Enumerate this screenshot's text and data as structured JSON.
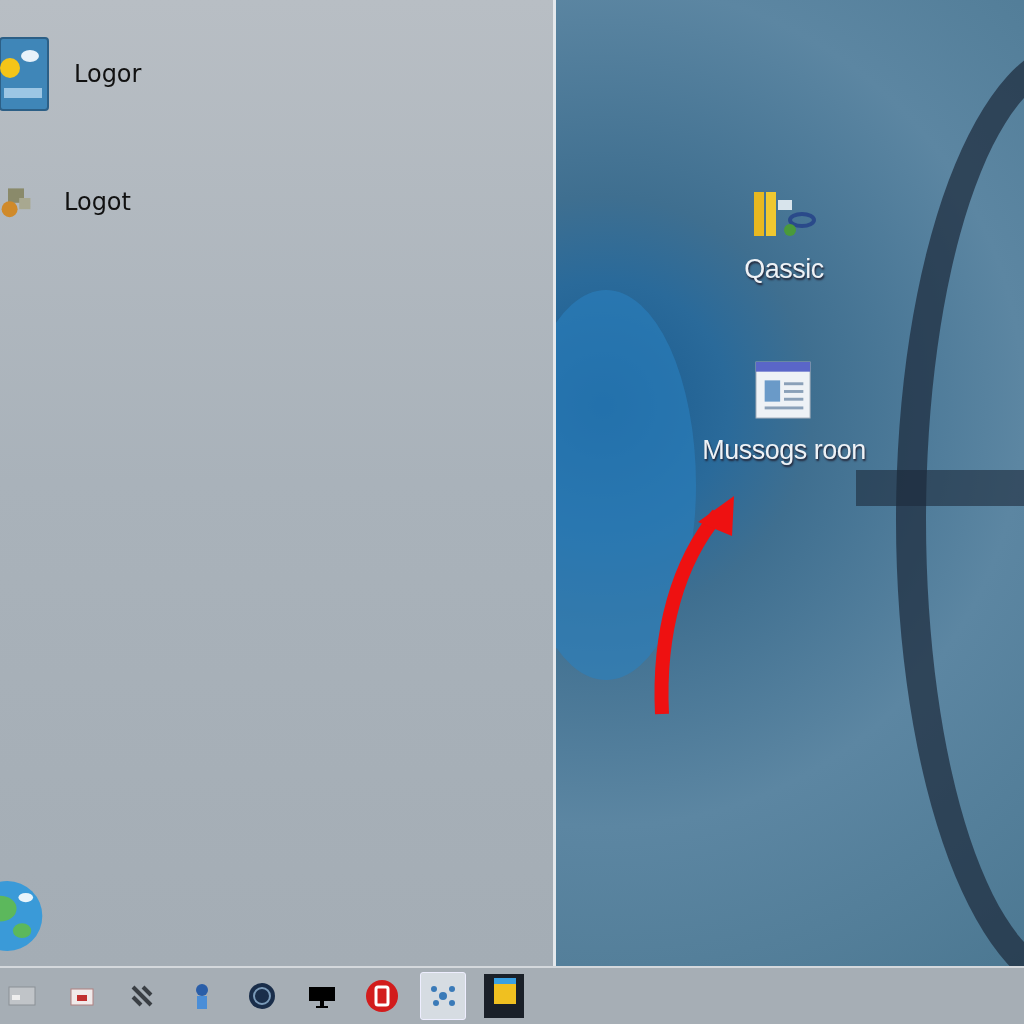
{
  "left_panel": {
    "items": [
      {
        "label": "Logor",
        "kind": "weather"
      },
      {
        "label": "Logot",
        "kind": "tools"
      }
    ]
  },
  "desktop": {
    "icons": [
      {
        "label": "Qassic",
        "kind": "files"
      },
      {
        "label": "Mussogs roon",
        "kind": "document"
      }
    ]
  },
  "taskbar": {
    "items": [
      {
        "kind": "window",
        "selected": false
      },
      {
        "kind": "toolbox",
        "selected": false
      },
      {
        "kind": "wrench",
        "selected": false
      },
      {
        "kind": "person",
        "selected": false
      },
      {
        "kind": "dial",
        "selected": false
      },
      {
        "kind": "monitor",
        "selected": false
      },
      {
        "kind": "stop",
        "selected": false
      },
      {
        "kind": "network",
        "selected": true
      },
      {
        "kind": "film",
        "selected": false
      }
    ]
  }
}
